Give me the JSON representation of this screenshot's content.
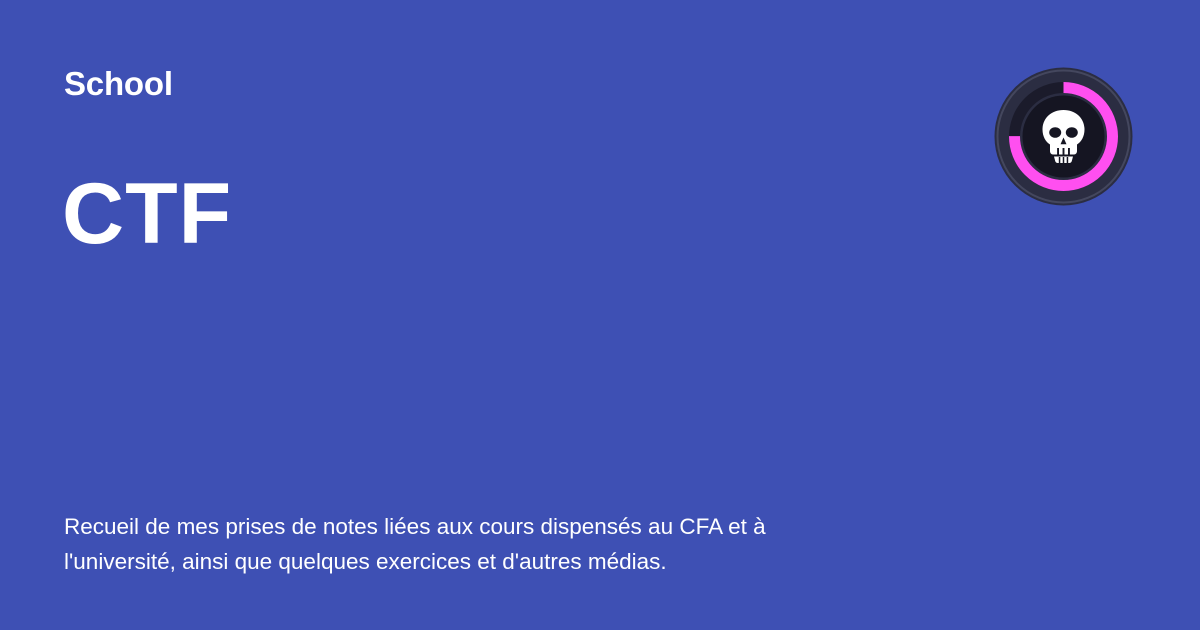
{
  "site": {
    "name": "School"
  },
  "page": {
    "title": "CTF",
    "description": "Recueil de mes prises de notes liées aux cours dispensés au CFA et à l'université, ainsi que quelques exercices et d'autres médias."
  },
  "logo": {
    "icon": "skull-icon",
    "progress_fraction": 0.75
  },
  "colors": {
    "background": "#3E50B4",
    "text": "#FFFFFF",
    "logo_outer": "#2B2D42",
    "logo_inner": "#151522",
    "logo_progress": "#FF4FF0"
  }
}
